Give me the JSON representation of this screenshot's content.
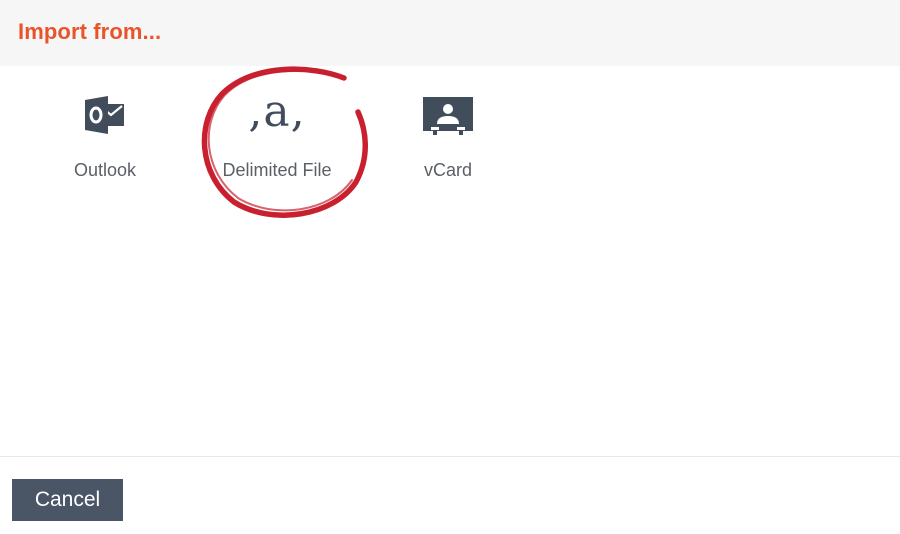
{
  "header": {
    "title": "Import from..."
  },
  "options": [
    {
      "label": "Outlook",
      "icon": "outlook-icon"
    },
    {
      "label": "Delimited File",
      "icon": "delimited-file-icon",
      "glyph": ",a,"
    },
    {
      "label": "vCard",
      "icon": "vcard-icon"
    }
  ],
  "annotation": {
    "type": "hand-drawn-circle",
    "color": "#c8202f",
    "target": "Delimited File"
  },
  "footer": {
    "cancel_label": "Cancel"
  },
  "colors": {
    "accent": "#e8552a",
    "icon": "#424d5c",
    "button": "#4a5566"
  }
}
